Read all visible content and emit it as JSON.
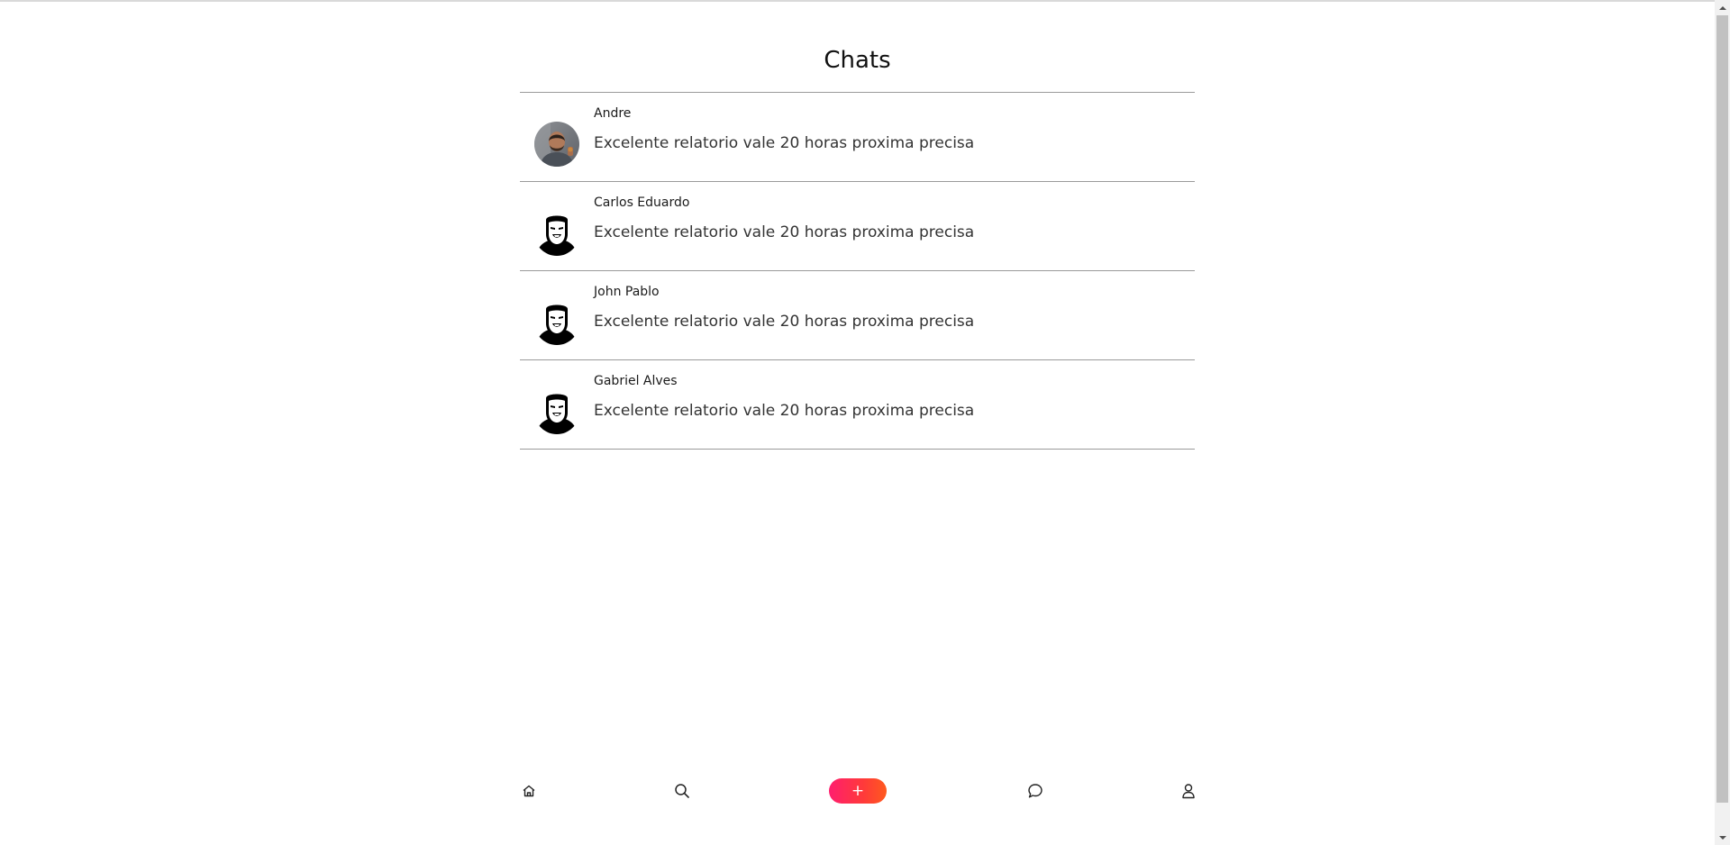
{
  "header": {
    "title": "Chats"
  },
  "chats": [
    {
      "name": "Andre",
      "preview": "Excelente relatorio vale 20 horas proxima precisa",
      "avatar": "user-photo"
    },
    {
      "name": "Carlos Eduardo",
      "preview": "Excelente relatorio vale 20 horas proxima precisa",
      "avatar": "default-avatar-icon"
    },
    {
      "name": "John Pablo",
      "preview": "Excelente relatorio vale 20 horas proxima precisa",
      "avatar": "default-avatar-icon"
    },
    {
      "name": "Gabriel Alves",
      "preview": "Excelente relatorio vale 20 horas proxima precisa",
      "avatar": "default-avatar-icon"
    }
  ],
  "bottom_nav": {
    "home_icon": "home-icon",
    "search_icon": "search-icon",
    "add_label": "+",
    "chat_icon": "chat-bubble-icon",
    "profile_icon": "user-icon"
  },
  "colors": {
    "accent_start": "#ff1e6e",
    "accent_end": "#ff5a1e",
    "divider": "#9a9a9a"
  }
}
